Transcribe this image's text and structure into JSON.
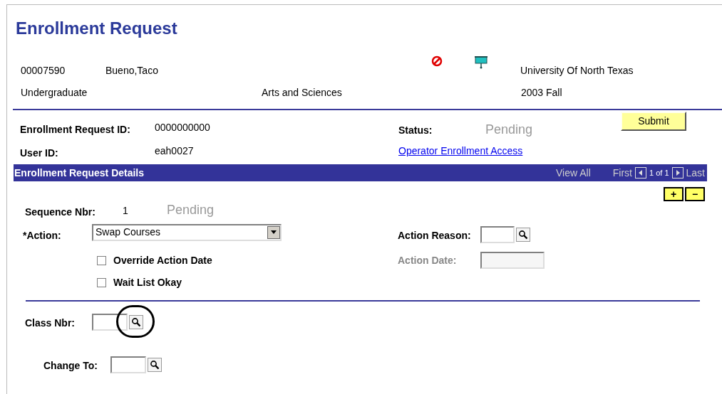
{
  "page_title": "Enrollment Request",
  "header": {
    "id": "00007590",
    "name": "Bueno,Taco",
    "institution": "University Of North Texas",
    "career": "Undergraduate",
    "program": "Arts and Sciences",
    "term": "2003 Fall"
  },
  "request": {
    "id_label": "Enrollment Request ID:",
    "id_value": "0000000000",
    "user_label": "User ID:",
    "user_value": "eah0027",
    "status_label": "Status:",
    "status_value": "Pending",
    "link": "Operator Enrollment Access",
    "submit": "Submit"
  },
  "details": {
    "title": "Enrollment Request Details",
    "view_all": "View All",
    "first": "First",
    "count": "1 of 1",
    "last": "Last",
    "add": "+",
    "remove": "−"
  },
  "sequence": {
    "label": "Sequence Nbr:",
    "value": "1",
    "status": "Pending"
  },
  "action": {
    "label": "*Action:",
    "value": "Swap Courses"
  },
  "checkboxes": [
    {
      "label": "Override Action Date",
      "checked": false
    },
    {
      "label": "Wait List Okay",
      "checked": false
    }
  ],
  "action_reason": {
    "label": "Action Reason:",
    "disabled": false
  },
  "action_date": {
    "label": "Action Date:",
    "disabled": true
  },
  "class_nbr": {
    "label": "Class Nbr:",
    "circled": true
  },
  "change_to": {
    "label": "Change To:"
  }
}
